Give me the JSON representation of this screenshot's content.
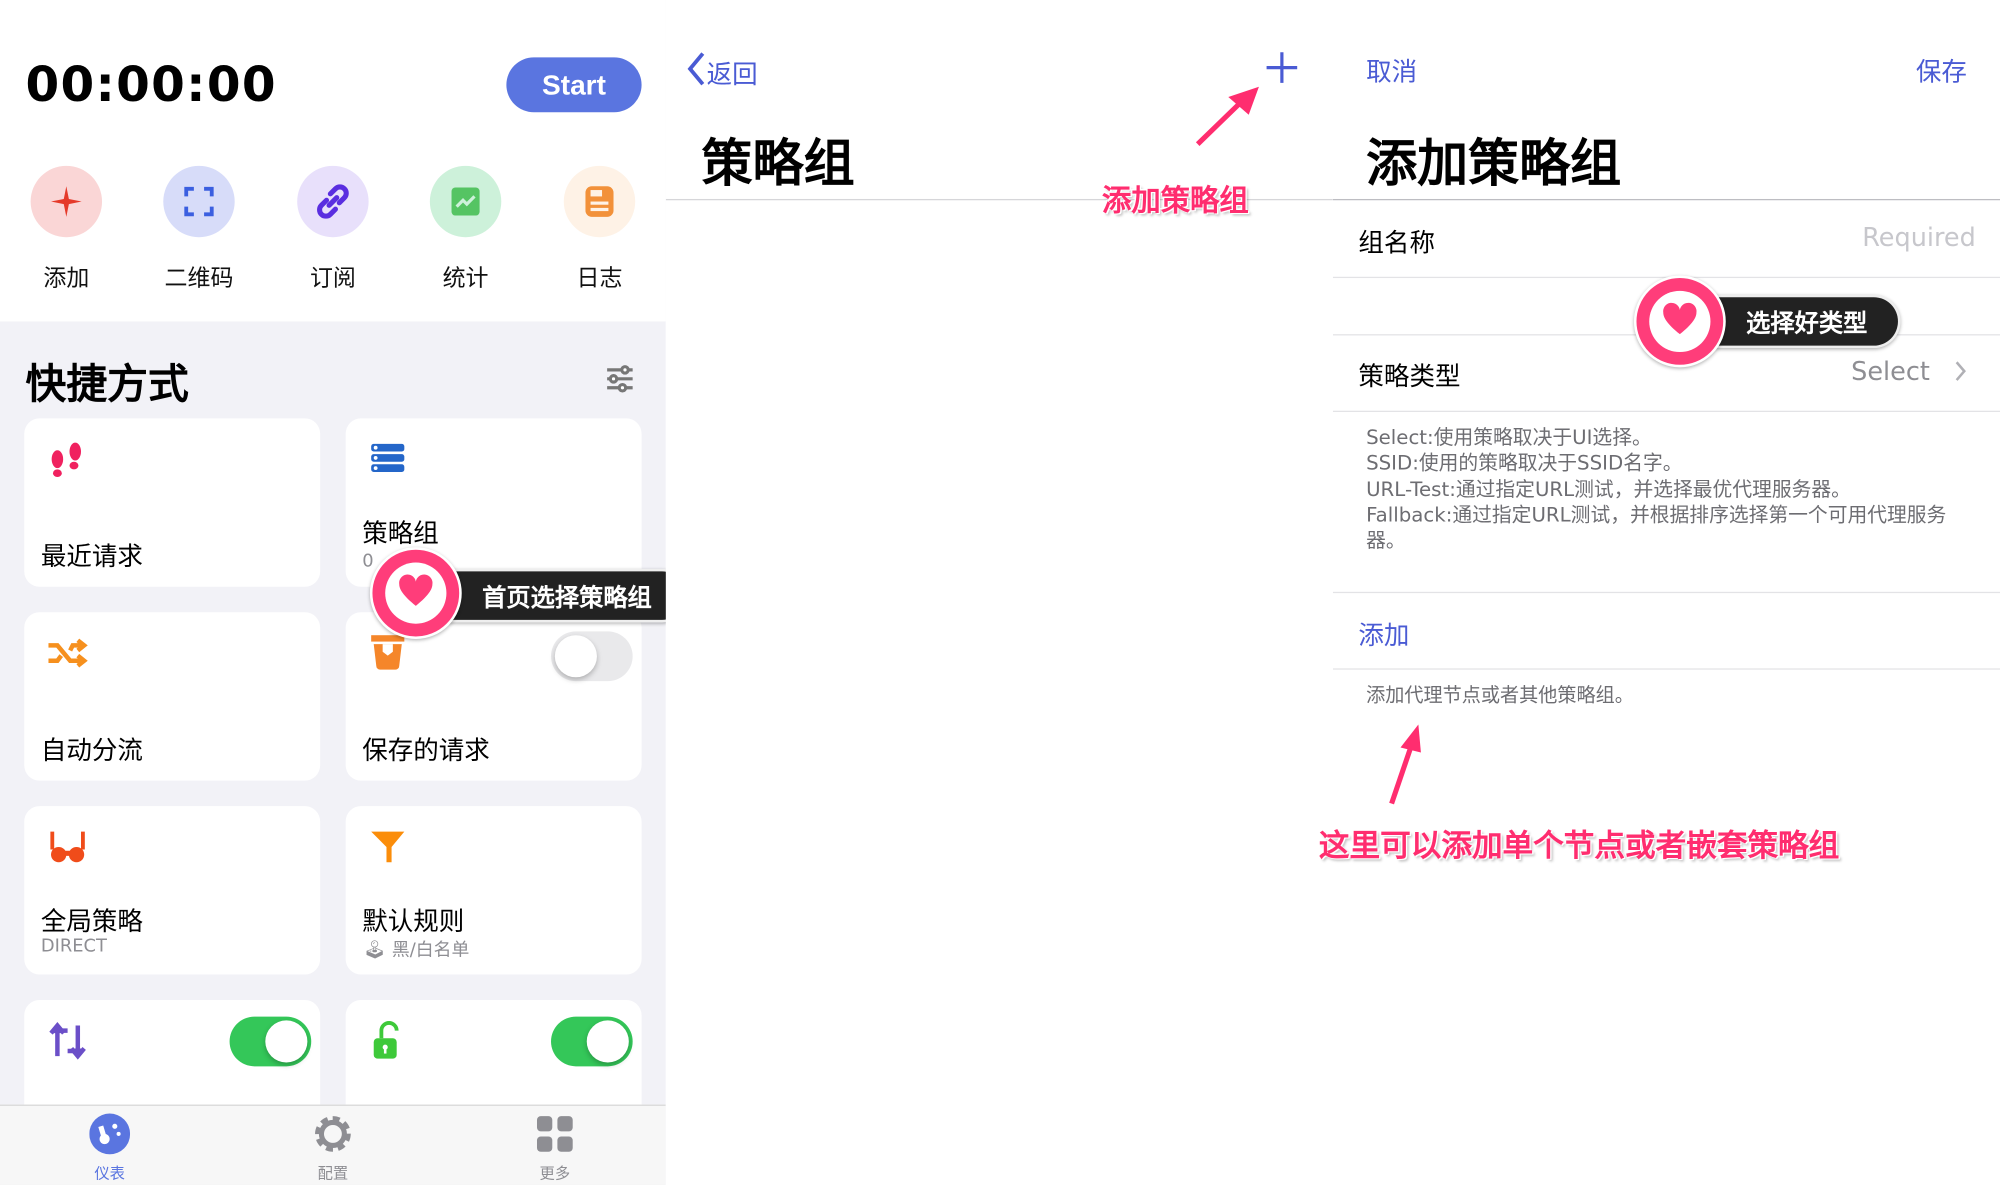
{
  "dashboard": {
    "timer": "00:00:00",
    "start_label": "Start",
    "quick_actions": [
      {
        "label": "添加",
        "icon": "sparkle-icon",
        "color": "#e53a2a",
        "bg": "#fad6d6"
      },
      {
        "label": "二维码",
        "icon": "qr-scan-icon",
        "color": "#3b5fe0",
        "bg": "#d7dcf9"
      },
      {
        "label": "订阅",
        "icon": "link-icon",
        "color": "#5a2ee0",
        "bg": "#e8e0fb"
      },
      {
        "label": "统计",
        "icon": "chart-icon",
        "color": "#55c463",
        "bg": "#cdf1da"
      },
      {
        "label": "日志",
        "icon": "log-icon",
        "color": "#f2913a",
        "bg": "#fef2e6"
      }
    ],
    "shortcuts_title": "快捷方式",
    "cards": [
      {
        "title": "最近请求",
        "icon": "footprints-icon",
        "color": "#f0215f"
      },
      {
        "title": "策略组",
        "subtitle": "0",
        "icon": "server-stack-icon",
        "color": "#2466c9"
      },
      {
        "title": "自动分流",
        "icon": "shuffle-icon",
        "color": "#f6901e"
      },
      {
        "title": "保存的请求",
        "icon": "bucket-icon",
        "color": "#f5862a",
        "toggle": false
      },
      {
        "title": "全局策略",
        "subtitle": "DIRECT",
        "icon": "glasses-icon",
        "color": "#f04c1a"
      },
      {
        "title": "默认规则",
        "subtitle": "黑/白名单",
        "icon": "funnel-icon",
        "color": "#fb8d0a"
      },
      {
        "icon": "rewrite-arrows-icon",
        "color": "#6b4fc8",
        "toggle": true
      },
      {
        "icon": "unlock-icon",
        "color": "#3ec93a",
        "toggle": true
      }
    ],
    "tabs": [
      {
        "label": "仪表",
        "icon": "dashboard-icon",
        "active": true
      },
      {
        "label": "配置",
        "icon": "gear-icon",
        "active": false
      },
      {
        "label": "更多",
        "icon": "grid-icon",
        "active": false
      }
    ],
    "callout": "首页选择策略组"
  },
  "policy_groups": {
    "back_label": "返回",
    "title": "策略组",
    "annotation": "添加策略组"
  },
  "add_group": {
    "cancel_label": "取消",
    "save_label": "保存",
    "title": "添加策略组",
    "name_label": "组名称",
    "name_placeholder": "Required",
    "type_label": "策略类型",
    "type_value": "Select",
    "type_help": [
      "Select:使用策略取决于UI选择。",
      "SSID:使用的策略取决于SSID名字。",
      "URL-Test:通过指定URL测试，并选择最优代理服务器。",
      "Fallback:通过指定URL测试，并根据排序选择第一个可用代理服务器。"
    ],
    "add_label": "添加",
    "add_help": "添加代理节点或者其他策略组。",
    "callout": "选择好类型",
    "annotation": "这里可以添加单个节点或者嵌套策略组"
  },
  "colors": {
    "accent": "#4a5bd4",
    "start": "#5a75e0",
    "annotation": "#ff2d6f",
    "toggle_on": "#34c759"
  }
}
